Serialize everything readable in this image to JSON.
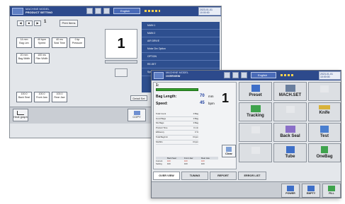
{
  "back_screen": {
    "title_line1": "MACHINE MODEL",
    "title_line2": "PRODUCT SETTING",
    "language": "English",
    "clock_line1": "2023-01-01",
    "clock_line2": "10:00:00",
    "counter": "1",
    "top_button": "Print Items",
    "param_tiles": [
      {
        "value": "14 mm",
        "label": "Bag Len"
      },
      {
        "value": "40 bpm",
        "label": "Speed"
      },
      {
        "value": "40 ms",
        "label": "Seal Time"
      },
      {
        "value": "0 kp",
        "label": "Pressure"
      },
      {
        "value": "20 mm",
        "label": "Bag Width"
      },
      {
        "value": "100 ms",
        "label": "Film Width"
      }
    ],
    "big_number": "1",
    "menu_items": [
      "MAIN 1",
      "MAIN 2",
      "AIR DRIVE",
      "Motor Drv Option",
      "OPTION",
      "RE-SET",
      "Speed & Option"
    ],
    "bottom_tiles": [
      {
        "value": "100.0",
        "label": "Back Seal"
      },
      {
        "value": "100.0",
        "label": "Front Jaw"
      },
      {
        "value": "100.0",
        "label": "Rear Jaw"
      }
    ],
    "detail_button": "Detail Set",
    "footer_left": "Heat graph",
    "footer_buttons": [
      "COPY",
      "OUTPUT",
      "SET"
    ]
  },
  "front_screen": {
    "title_line1": "MACHINE MODEL",
    "title_line2": "OVERVIEW",
    "language": "English",
    "clock_line1": "2023-01-01",
    "clock_line2": "10:00:00",
    "product_no": "1:",
    "bag_length_label": "Bag Length:",
    "bag_length_value": "70",
    "bag_length_unit": "mm",
    "speed_label": "Speed:",
    "speed_value": "45",
    "speed_unit": "bpm",
    "big_number": "1",
    "stats": [
      {
        "label": "Total Count",
        "value": "0 Bag"
      },
      {
        "label": "Good Bags",
        "value": "0 Bag"
      },
      {
        "label": "NG Bags",
        "value": "0 Bag"
      },
      {
        "label": "Product Time",
        "value": "0 min"
      },
      {
        "label": "Efficiency",
        "value": "0 %"
      },
      {
        "label": "Total Bag/min",
        "value": "0 bpm"
      },
      {
        "label": "NG/Min",
        "value": "0 bpm"
      }
    ],
    "clear_button": "Clear",
    "temp_table": {
      "headers": [
        "",
        "Back Seal",
        "Front Jaw",
        "Rear Jaw"
      ],
      "rows": [
        {
          "label": "Current",
          "values": [
            "100",
            "100",
            "100"
          ]
        },
        {
          "label": "Setting",
          "values": [
            "100",
            "100",
            "100"
          ]
        }
      ]
    },
    "control_tiles": [
      {
        "label": "Preset",
        "dim": false
      },
      {
        "label": "MACH.SET",
        "dim": false
      },
      {
        "label": "",
        "dim": true
      },
      {
        "label": "Tracking",
        "dim": false
      },
      {
        "label": "",
        "dim": true
      },
      {
        "label": "Knife",
        "dim": false
      },
      {
        "label": "",
        "dim": true
      },
      {
        "label": "Back Seal",
        "dim": false
      },
      {
        "label": "Test",
        "dim": false
      },
      {
        "label": "",
        "dim": true
      },
      {
        "label": "Tube",
        "dim": false
      },
      {
        "label": "OneBag",
        "dim": false
      }
    ],
    "tabs": [
      "OVER VIEW",
      "TUNING",
      "REPORT",
      "ERROR LIST"
    ],
    "bottom_buttons": [
      "POWER",
      "EMPTY",
      "FILL"
    ],
    "colors": {
      "title_bar": "#2d4a8c",
      "accent_green": "#33a02c",
      "value_blue": "#1f3f9e"
    }
  }
}
